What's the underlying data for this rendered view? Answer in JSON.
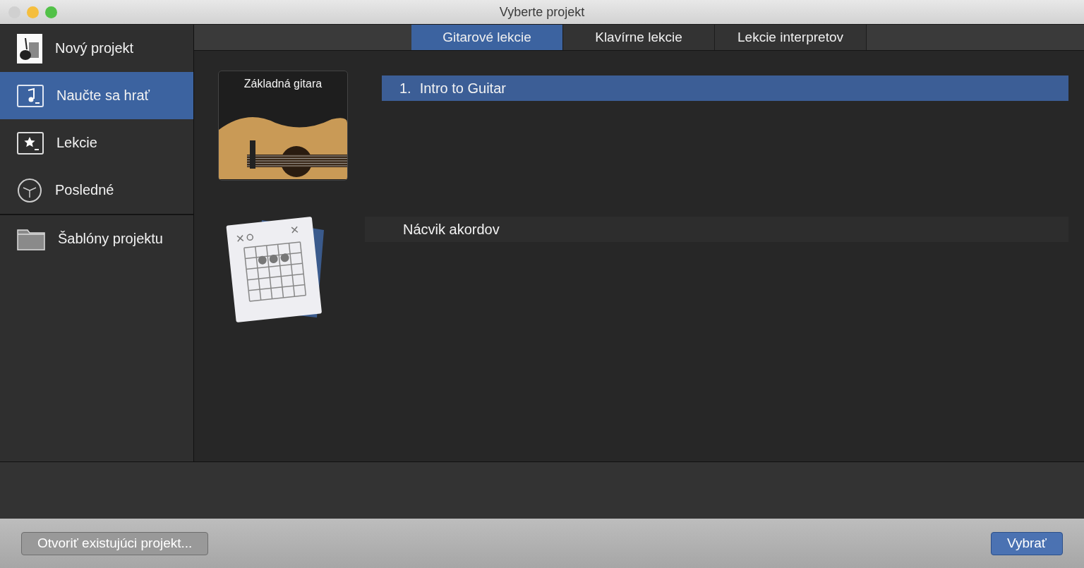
{
  "window": {
    "title": "Vyberte projekt"
  },
  "sidebar": {
    "items": [
      {
        "label": "Nový projekt",
        "kind": "project",
        "selected": false
      },
      {
        "label": "Naučte sa hrať",
        "kind": "learn",
        "selected": true
      },
      {
        "label": "Lekcie",
        "kind": "lessons",
        "selected": false
      },
      {
        "label": "Posledné",
        "kind": "recent",
        "selected": false
      },
      {
        "label": "Šablóny projektu",
        "kind": "templates",
        "selected": false
      }
    ]
  },
  "tabs": [
    {
      "label": "Gitarové lekcie",
      "selected": true
    },
    {
      "label": "Klavírne lekcie",
      "selected": false
    },
    {
      "label": "Lekcie interpretov",
      "selected": false
    }
  ],
  "courses": [
    {
      "kind": "photo",
      "title": "Základná gitara",
      "lessons": [
        {
          "number": "1.",
          "title": "Intro to Guitar",
          "selected": true
        }
      ]
    },
    {
      "kind": "chords",
      "lessons": [
        {
          "title": "Nácvik akordov",
          "selected": false
        }
      ]
    }
  ],
  "buttons": {
    "open": "Otvoriť existujúci projekt...",
    "choose": "Vybrať"
  }
}
